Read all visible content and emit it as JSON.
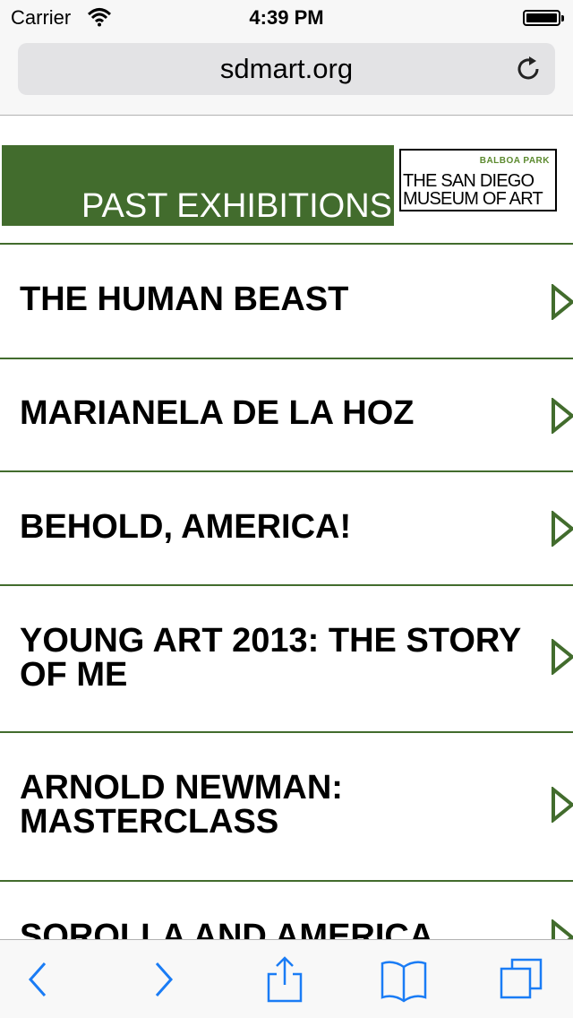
{
  "status_bar": {
    "carrier": "Carrier",
    "time": "4:39 PM",
    "icons": [
      "wifi-icon",
      "battery-icon"
    ]
  },
  "browser": {
    "url": "sdmart.org",
    "reload_icon": "reload-icon"
  },
  "header": {
    "title": "PAST EXHIBITIONS",
    "accent_color": "#426c2d",
    "logo": {
      "tagline": "BALBOA PARK",
      "line1": "THE SAN DIEGO",
      "line2": "MUSEUM OF ART"
    }
  },
  "exhibitions": [
    {
      "title": "THE HUMAN BEAST"
    },
    {
      "title": "MARIANELA DE LA HOZ"
    },
    {
      "title": "BEHOLD, AMERICA!"
    },
    {
      "title": "YOUNG ART 2013: THE STORY OF ME"
    },
    {
      "title": "ARNOLD NEWMAN: MASTERCLASS"
    },
    {
      "title": "SOROLLA AND AMERICA"
    }
  ],
  "toolbar": {
    "buttons": [
      "back-icon",
      "forward-icon",
      "share-icon",
      "bookmarks-icon",
      "tabs-icon"
    ],
    "tint_color": "#1a7cf5"
  }
}
